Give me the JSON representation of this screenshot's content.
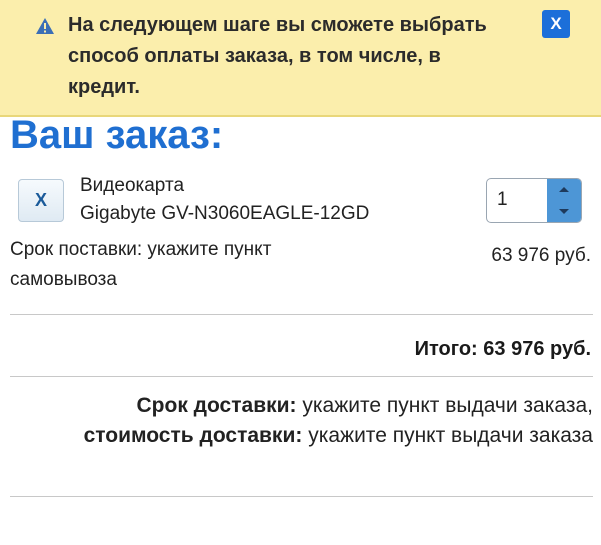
{
  "notice": {
    "text": "На следующем шаге вы сможете выбрать способ оплаты заказа, в том числе, в кредит.",
    "close_label": "X",
    "icon": "warning-icon"
  },
  "order": {
    "title": "Ваш заказ:",
    "item": {
      "remove_label": "X",
      "name_line1": "Видеокарта",
      "name_line2": "Gigabyte GV-N3060EAGLE-12GD",
      "quantity": "1",
      "delivery_line1": "Срок поставки: укажите пункт",
      "delivery_line2": "самовывоза",
      "price": "63 976 руб."
    },
    "total_label": "Итого:",
    "total_value": "63 976 руб.",
    "summary": {
      "delivery_term_label": "Срок доставки:",
      "delivery_term_value": "укажите пункт выдачи заказа",
      "delivery_cost_label": "стоимость доставки:",
      "delivery_cost_value": "укажите пункт выдачи заказа"
    }
  },
  "colors": {
    "notice_bg": "#fbeeac",
    "accent": "#1f6fd1",
    "button_blue": "#1c6fd9"
  }
}
